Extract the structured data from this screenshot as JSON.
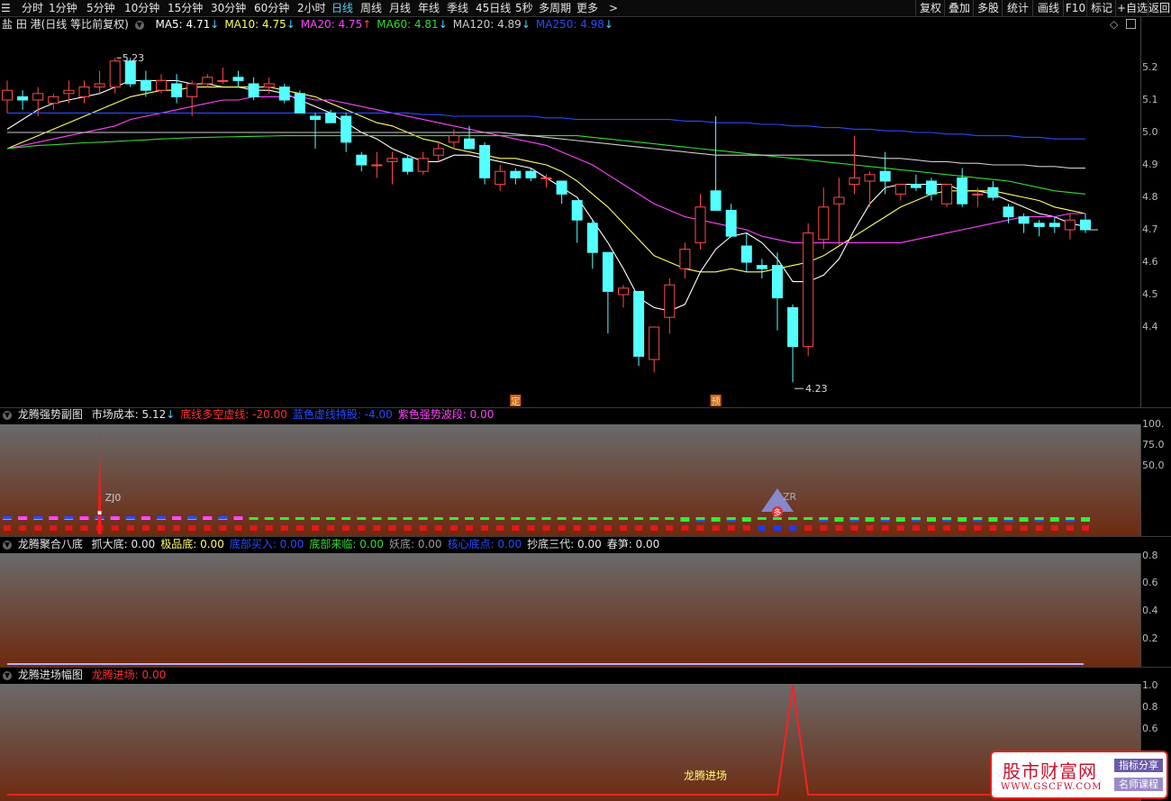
{
  "toolbar": {
    "periods": [
      "分时",
      "1分钟",
      "5分钟",
      "10分钟",
      "15分钟",
      "30分钟",
      "60分钟",
      "2小时",
      "日线",
      "周线",
      "月线",
      "年线",
      "季线",
      "45日线",
      "5秒",
      "多周期",
      "更多"
    ],
    "active_period": "日线",
    "right": [
      "复权",
      "叠加",
      "多股",
      "统计",
      "画线",
      "F10",
      "标记",
      "+自选",
      "返回"
    ]
  },
  "main": {
    "stock": "盐 田 港(日线 等比前复权)",
    "ma": [
      {
        "label": "MA5: 4.71",
        "arrow": "↓",
        "color": "#ffffff"
      },
      {
        "label": "MA10: 4.75",
        "arrow": "↓",
        "color": "#ffff66"
      },
      {
        "label": "MA20: 4.75",
        "arrow": "↑",
        "color": "#ff44ff"
      },
      {
        "label": "MA60: 4.81",
        "arrow": "↓",
        "color": "#33dd33"
      },
      {
        "label": "MA120: 4.89",
        "arrow": "↓",
        "color": "#cccccc"
      },
      {
        "label": "MA250: 4.98",
        "arrow": "↓",
        "color": "#2a4bff"
      }
    ],
    "high_label": "5.23",
    "low_label": "4.23",
    "marker1": "定",
    "marker2": "预",
    "axis": [
      "5.2",
      "5.1",
      "5.0",
      "4.9",
      "4.8",
      "4.7",
      "4.6",
      "4.5",
      "4.4"
    ]
  },
  "panel1": {
    "name": "龙腾强势副图",
    "fields": [
      {
        "label": "市场成本: 5.12",
        "arrow": "↓",
        "color": "#e6e6e6"
      },
      {
        "label": "底线多空虚线: -20.00",
        "arrow": "",
        "color": "#ff3030"
      },
      {
        "label": "蓝色虚线持股: -4.00",
        "arrow": "",
        "color": "#2a4bff"
      },
      {
        "label": "紫色强势波段: 0.00",
        "arrow": "",
        "color": "#ff44ff"
      }
    ],
    "axis": [
      "100.",
      "75.0",
      "50.0"
    ],
    "zj_label": "ZJ0",
    "zr_label": "ZR",
    "duo": "多"
  },
  "panel2": {
    "name": "龙腾聚合八底",
    "fields": [
      {
        "label": "抓大底: 0.00",
        "color": "#e6e6e6"
      },
      {
        "label": "极品底: 0.00",
        "color": "#ffff66"
      },
      {
        "label": "底部买入: 0.00",
        "color": "#2a4bff"
      },
      {
        "label": "底部来临: 0.00",
        "color": "#33dd33"
      },
      {
        "label": "妖底: 0.00",
        "color": "#999999"
      },
      {
        "label": "核心底点: 0.00",
        "color": "#2a4bff"
      },
      {
        "label": "抄底三代: 0.00",
        "color": "#e6e6e6"
      },
      {
        "label": "春笋: 0.00",
        "color": "#e6e6e6"
      }
    ],
    "axis": [
      "0.8",
      "0.6",
      "0.4",
      "0.2"
    ]
  },
  "panel3": {
    "name": "龙腾进场幅图",
    "fields": [
      {
        "label": "龙腾进场: 0.00",
        "color": "#ff3030"
      }
    ],
    "axis": [
      "1.0",
      "0.8",
      "0.6"
    ],
    "entry_label": "龙腾进场"
  },
  "watermark": {
    "main": "股市财富网",
    "url": "WWW.GSCFW.COM",
    "tag1": "指标分享",
    "tag2": "名师课程"
  },
  "chart_data": {
    "type": "candlestick",
    "candles": [
      {
        "o": 5.1,
        "h": 5.16,
        "l": 5.06,
        "c": 5.13
      },
      {
        "o": 5.11,
        "h": 5.13,
        "l": 5.07,
        "c": 5.1
      },
      {
        "o": 5.1,
        "h": 5.14,
        "l": 5.05,
        "c": 5.12
      },
      {
        "o": 5.09,
        "h": 5.12,
        "l": 5.07,
        "c": 5.11
      },
      {
        "o": 5.12,
        "h": 5.16,
        "l": 5.09,
        "c": 5.13
      },
      {
        "o": 5.11,
        "h": 5.16,
        "l": 5.09,
        "c": 5.14
      },
      {
        "o": 5.14,
        "h": 5.19,
        "l": 5.12,
        "c": 5.15
      },
      {
        "o": 5.14,
        "h": 5.23,
        "l": 5.12,
        "c": 5.22
      },
      {
        "o": 5.22,
        "h": 5.23,
        "l": 5.14,
        "c": 5.15
      },
      {
        "o": 5.16,
        "h": 5.19,
        "l": 5.11,
        "c": 5.13
      },
      {
        "o": 5.13,
        "h": 5.18,
        "l": 5.12,
        "c": 5.16
      },
      {
        "o": 5.15,
        "h": 5.18,
        "l": 5.09,
        "c": 5.11
      },
      {
        "o": 5.11,
        "h": 5.16,
        "l": 5.05,
        "c": 5.15
      },
      {
        "o": 5.15,
        "h": 5.18,
        "l": 5.14,
        "c": 5.17
      },
      {
        "o": 5.16,
        "h": 5.2,
        "l": 5.15,
        "c": 5.16
      },
      {
        "o": 5.17,
        "h": 5.19,
        "l": 5.14,
        "c": 5.16
      },
      {
        "o": 5.15,
        "h": 5.17,
        "l": 5.1,
        "c": 5.11
      },
      {
        "o": 5.14,
        "h": 5.17,
        "l": 5.12,
        "c": 5.15
      },
      {
        "o": 5.14,
        "h": 5.15,
        "l": 5.09,
        "c": 5.1
      },
      {
        "o": 5.12,
        "h": 5.13,
        "l": 5.06,
        "c": 5.06
      },
      {
        "o": 5.05,
        "h": 5.06,
        "l": 4.95,
        "c": 5.04
      },
      {
        "o": 5.06,
        "h": 5.07,
        "l": 5.04,
        "c": 5.03
      },
      {
        "o": 5.05,
        "h": 5.06,
        "l": 4.94,
        "c": 4.97
      },
      {
        "o": 4.93,
        "h": 4.94,
        "l": 4.88,
        "c": 4.9
      },
      {
        "o": 4.9,
        "h": 4.94,
        "l": 4.86,
        "c": 4.9
      },
      {
        "o": 4.91,
        "h": 4.94,
        "l": 4.84,
        "c": 4.92
      },
      {
        "o": 4.92,
        "h": 4.93,
        "l": 4.87,
        "c": 4.88
      },
      {
        "o": 4.88,
        "h": 4.94,
        "l": 4.87,
        "c": 4.92
      },
      {
        "o": 4.93,
        "h": 4.97,
        "l": 4.91,
        "c": 4.95
      },
      {
        "o": 4.97,
        "h": 5.01,
        "l": 4.95,
        "c": 4.99
      },
      {
        "o": 4.98,
        "h": 5.02,
        "l": 4.96,
        "c": 4.95
      },
      {
        "o": 4.96,
        "h": 4.97,
        "l": 4.84,
        "c": 4.86
      },
      {
        "o": 4.84,
        "h": 4.9,
        "l": 4.82,
        "c": 4.88
      },
      {
        "o": 4.88,
        "h": 4.89,
        "l": 4.84,
        "c": 4.86
      },
      {
        "o": 4.88,
        "h": 4.89,
        "l": 4.85,
        "c": 4.86
      },
      {
        "o": 4.86,
        "h": 4.87,
        "l": 4.83,
        "c": 4.86
      },
      {
        "o": 4.85,
        "h": 4.85,
        "l": 4.78,
        "c": 4.81
      },
      {
        "o": 4.79,
        "h": 4.79,
        "l": 4.66,
        "c": 4.73
      },
      {
        "o": 4.72,
        "h": 4.73,
        "l": 4.58,
        "c": 4.63
      },
      {
        "o": 4.63,
        "h": 4.63,
        "l": 4.38,
        "c": 4.51
      },
      {
        "o": 4.5,
        "h": 4.53,
        "l": 4.46,
        "c": 4.52
      },
      {
        "o": 4.51,
        "h": 4.51,
        "l": 4.28,
        "c": 4.31
      },
      {
        "o": 4.3,
        "h": 4.4,
        "l": 4.26,
        "c": 4.4
      },
      {
        "o": 4.43,
        "h": 4.55,
        "l": 4.38,
        "c": 4.53
      },
      {
        "o": 4.58,
        "h": 4.66,
        "l": 4.55,
        "c": 4.64
      },
      {
        "o": 4.66,
        "h": 4.81,
        "l": 4.64,
        "c": 4.77
      },
      {
        "o": 4.82,
        "h": 5.05,
        "l": 4.77,
        "c": 4.76
      },
      {
        "o": 4.76,
        "h": 4.78,
        "l": 4.69,
        "c": 4.68
      },
      {
        "o": 4.65,
        "h": 4.69,
        "l": 4.57,
        "c": 4.6
      },
      {
        "o": 4.59,
        "h": 4.61,
        "l": 4.55,
        "c": 4.58
      },
      {
        "o": 4.59,
        "h": 4.63,
        "l": 4.39,
        "c": 4.49
      },
      {
        "o": 4.46,
        "h": 4.47,
        "l": 4.23,
        "c": 4.34
      },
      {
        "o": 4.34,
        "h": 4.72,
        "l": 4.31,
        "c": 4.69
      },
      {
        "o": 4.67,
        "h": 4.83,
        "l": 4.64,
        "c": 4.77
      },
      {
        "o": 4.78,
        "h": 4.86,
        "l": 4.65,
        "c": 4.8
      },
      {
        "o": 4.84,
        "h": 4.99,
        "l": 4.81,
        "c": 4.86
      },
      {
        "o": 4.85,
        "h": 4.88,
        "l": 4.77,
        "c": 4.87
      },
      {
        "o": 4.88,
        "h": 4.94,
        "l": 4.81,
        "c": 4.85
      },
      {
        "o": 4.81,
        "h": 4.84,
        "l": 4.79,
        "c": 4.84
      },
      {
        "o": 4.84,
        "h": 4.87,
        "l": 4.82,
        "c": 4.83
      },
      {
        "o": 4.85,
        "h": 4.86,
        "l": 4.79,
        "c": 4.81
      },
      {
        "o": 4.78,
        "h": 4.84,
        "l": 4.77,
        "c": 4.84
      },
      {
        "o": 4.86,
        "h": 4.89,
        "l": 4.77,
        "c": 4.78
      },
      {
        "o": 4.81,
        "h": 4.83,
        "l": 4.77,
        "c": 4.81
      },
      {
        "o": 4.83,
        "h": 4.85,
        "l": 4.79,
        "c": 4.8
      },
      {
        "o": 4.77,
        "h": 4.78,
        "l": 4.72,
        "c": 4.74
      },
      {
        "o": 4.74,
        "h": 4.75,
        "l": 4.69,
        "c": 4.72
      },
      {
        "o": 4.72,
        "h": 4.73,
        "l": 4.68,
        "c": 4.71
      },
      {
        "o": 4.72,
        "h": 4.74,
        "l": 4.69,
        "c": 4.71
      },
      {
        "o": 4.7,
        "h": 4.75,
        "l": 4.67,
        "c": 4.73
      },
      {
        "o": 4.73,
        "h": 4.75,
        "l": 4.69,
        "c": 4.7
      }
    ],
    "ma_lines": {
      "MA5": [
        5.01,
        5.04,
        5.07,
        5.09,
        5.1,
        5.11,
        5.12,
        5.14,
        5.16,
        5.16,
        5.16,
        5.16,
        5.15,
        5.15,
        5.14,
        5.14,
        5.13,
        5.13,
        5.12,
        5.1,
        5.08,
        5.06,
        5.03,
        5.0,
        4.98,
        4.95,
        4.93,
        4.91,
        4.91,
        4.93,
        4.93,
        4.92,
        4.91,
        4.9,
        4.89,
        4.86,
        4.83,
        4.8,
        4.73,
        4.66,
        4.58,
        4.49,
        4.46,
        4.45,
        4.47,
        4.57,
        4.64,
        4.68,
        4.69,
        4.66,
        4.61,
        4.54,
        4.54,
        4.56,
        4.61,
        4.7,
        4.78,
        4.83,
        4.84,
        4.84,
        4.84,
        4.84,
        4.82,
        4.82,
        4.81,
        4.79,
        4.77,
        4.75,
        4.74,
        4.72,
        4.71
      ],
      "MA10": [
        4.95,
        4.97,
        4.99,
        5.01,
        5.03,
        5.05,
        5.07,
        5.09,
        5.11,
        5.12,
        5.13,
        5.13,
        5.14,
        5.14,
        5.14,
        5.14,
        5.14,
        5.14,
        5.13,
        5.12,
        5.11,
        5.09,
        5.07,
        5.05,
        5.03,
        5.02,
        5.0,
        4.98,
        4.97,
        4.95,
        4.94,
        4.93,
        4.92,
        4.92,
        4.91,
        4.9,
        4.88,
        4.85,
        4.81,
        4.77,
        4.72,
        4.67,
        4.62,
        4.6,
        4.58,
        4.57,
        4.57,
        4.58,
        4.57,
        4.57,
        4.58,
        4.59,
        4.6,
        4.62,
        4.65,
        4.68,
        4.71,
        4.74,
        4.77,
        4.79,
        4.81,
        4.82,
        4.82,
        4.82,
        4.82,
        4.81,
        4.8,
        4.79,
        4.77,
        4.76,
        4.75
      ],
      "MA20": [
        4.95,
        4.96,
        4.97,
        4.98,
        4.99,
        5.0,
        5.01,
        5.02,
        5.04,
        5.05,
        5.06,
        5.07,
        5.08,
        5.09,
        5.1,
        5.1,
        5.11,
        5.11,
        5.11,
        5.11,
        5.1,
        5.1,
        5.09,
        5.08,
        5.07,
        5.06,
        5.05,
        5.04,
        5.03,
        5.02,
        5.01,
        5.0,
        4.99,
        4.98,
        4.97,
        4.96,
        4.94,
        4.92,
        4.9,
        4.87,
        4.84,
        4.81,
        4.78,
        4.76,
        4.74,
        4.73,
        4.72,
        4.71,
        4.7,
        4.68,
        4.67,
        4.66,
        4.66,
        4.66,
        4.66,
        4.66,
        4.66,
        4.66,
        4.66,
        4.67,
        4.68,
        4.69,
        4.7,
        4.71,
        4.72,
        4.73,
        4.74,
        4.74,
        4.74,
        4.75,
        4.75
      ],
      "MA60": [
        4.95,
        4.955,
        4.96,
        4.962,
        4.965,
        4.968,
        4.97,
        4.972,
        4.975,
        4.977,
        4.98,
        4.982,
        4.984,
        4.985,
        4.986,
        4.987,
        4.988,
        4.989,
        4.99,
        4.99,
        4.99,
        4.99,
        4.99,
        4.99,
        4.99,
        4.99,
        4.99,
        4.99,
        4.99,
        4.99,
        4.99,
        4.99,
        4.99,
        4.99,
        4.99,
        4.99,
        4.99,
        4.99,
        4.985,
        4.98,
        4.975,
        4.97,
        4.965,
        4.96,
        4.955,
        4.95,
        4.945,
        4.94,
        4.935,
        4.93,
        4.925,
        4.92,
        4.915,
        4.91,
        4.905,
        4.9,
        4.895,
        4.89,
        4.885,
        4.88,
        4.875,
        4.87,
        4.865,
        4.86,
        4.855,
        4.85,
        4.84,
        4.83,
        4.82,
        4.815,
        4.81
      ],
      "MA120": [
        5.0,
        5.0,
        5.0,
        5.0,
        5.0,
        5.0,
        5.0,
        5.0,
        5.0,
        5.0,
        5.0,
        5.0,
        5.0,
        5.0,
        5.0,
        5.0,
        5.0,
        5.0,
        5.0,
        5.0,
        5.0,
        5.0,
        5.0,
        5.0,
        5.0,
        5.0,
        5.0,
        5.0,
        5.0,
        5.0,
        5.0,
        5.0,
        5.0,
        4.995,
        4.99,
        4.985,
        4.98,
        4.975,
        4.97,
        4.965,
        4.96,
        4.955,
        4.95,
        4.945,
        4.94,
        4.935,
        4.93,
        4.93,
        4.93,
        4.93,
        4.93,
        4.93,
        4.93,
        4.93,
        4.93,
        4.93,
        4.925,
        4.92,
        4.92,
        4.915,
        4.91,
        4.91,
        4.905,
        4.905,
        4.9,
        4.9,
        4.9,
        4.895,
        4.895,
        4.89,
        4.89
      ],
      "MA250": [
        5.06,
        5.06,
        5.06,
        5.06,
        5.06,
        5.06,
        5.06,
        5.06,
        5.06,
        5.06,
        5.06,
        5.06,
        5.06,
        5.06,
        5.06,
        5.06,
        5.06,
        5.06,
        5.06,
        5.06,
        5.06,
        5.06,
        5.06,
        5.06,
        5.06,
        5.06,
        5.06,
        5.055,
        5.055,
        5.05,
        5.05,
        5.05,
        5.05,
        5.05,
        5.05,
        5.045,
        5.045,
        5.04,
        5.04,
        5.04,
        5.04,
        5.04,
        5.04,
        5.04,
        5.035,
        5.035,
        5.03,
        5.03,
        5.03,
        5.025,
        5.025,
        5.02,
        5.02,
        5.015,
        5.015,
        5.01,
        5.01,
        5.005,
        5.005,
        5.0,
        5.0,
        4.995,
        4.995,
        4.99,
        4.99,
        4.99,
        4.985,
        4.985,
        4.98,
        4.98,
        4.98
      ]
    },
    "ylim": [
      4.2,
      5.25
    ]
  }
}
